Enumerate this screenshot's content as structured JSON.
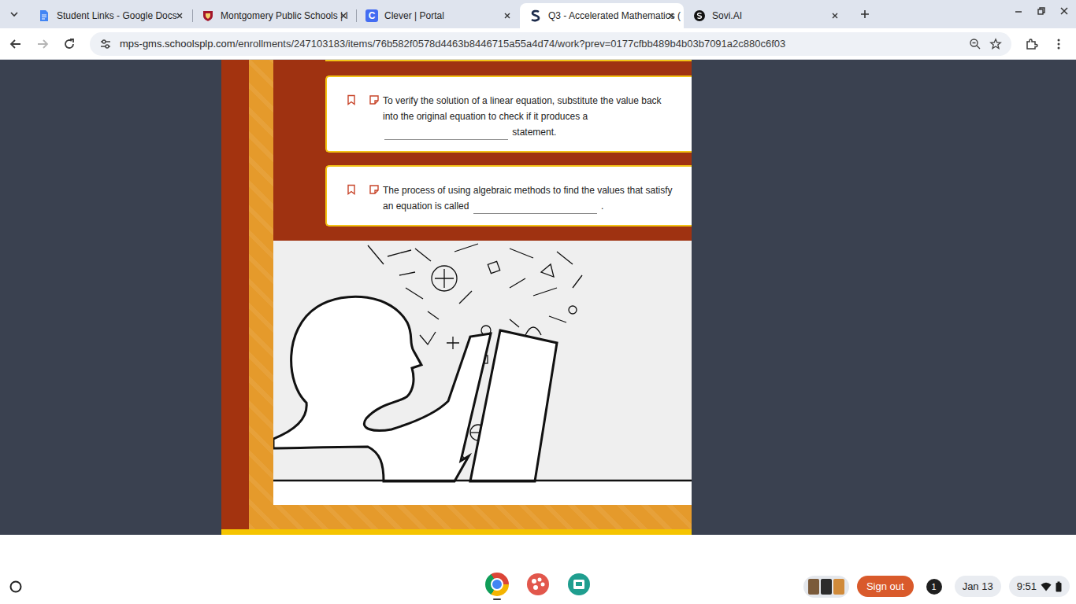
{
  "browser": {
    "tabs": [
      {
        "label": "Student Links - Google Docs",
        "selected": false,
        "kind": "docs"
      },
      {
        "label": "Montgomery Public Schools | I",
        "selected": false,
        "kind": "shield"
      },
      {
        "label": "Clever | Portal",
        "selected": false,
        "kind": "clever",
        "icon_text": "C"
      },
      {
        "label": "Q3 - Accelerated Mathematics (",
        "selected": true,
        "kind": "sovi"
      },
      {
        "label": "Sovi.AI",
        "selected": false,
        "kind": "sovi-ai"
      }
    ],
    "nav": {
      "back_enabled": true,
      "forward_enabled": false
    },
    "address": {
      "host": "mps-gms.schoolsplp.com",
      "path": "/enrollments/247103183/items/76b582f0578d4463b8446715a55a4d74/work?prev=0177cfbb489b4b03b7091a2c880c6f03"
    }
  },
  "questions": [
    {
      "before": "To verify the solution of a linear equation, substitute the value back into the original equation to check if it produces a",
      "after": "statement.",
      "answer": ""
    },
    {
      "before": "The process of using algebraic methods to find the values that satisfy an equation is called",
      "after": ".",
      "answer": ""
    }
  ],
  "shelf": {
    "apps": [
      {
        "kind": "chrome",
        "running": true
      },
      {
        "kind": "canvas",
        "running": false
      },
      {
        "kind": "classroom",
        "running": false
      }
    ],
    "sign_out": "Sign out",
    "notifications": "1",
    "date": "Jan 13",
    "time": "9:51"
  }
}
